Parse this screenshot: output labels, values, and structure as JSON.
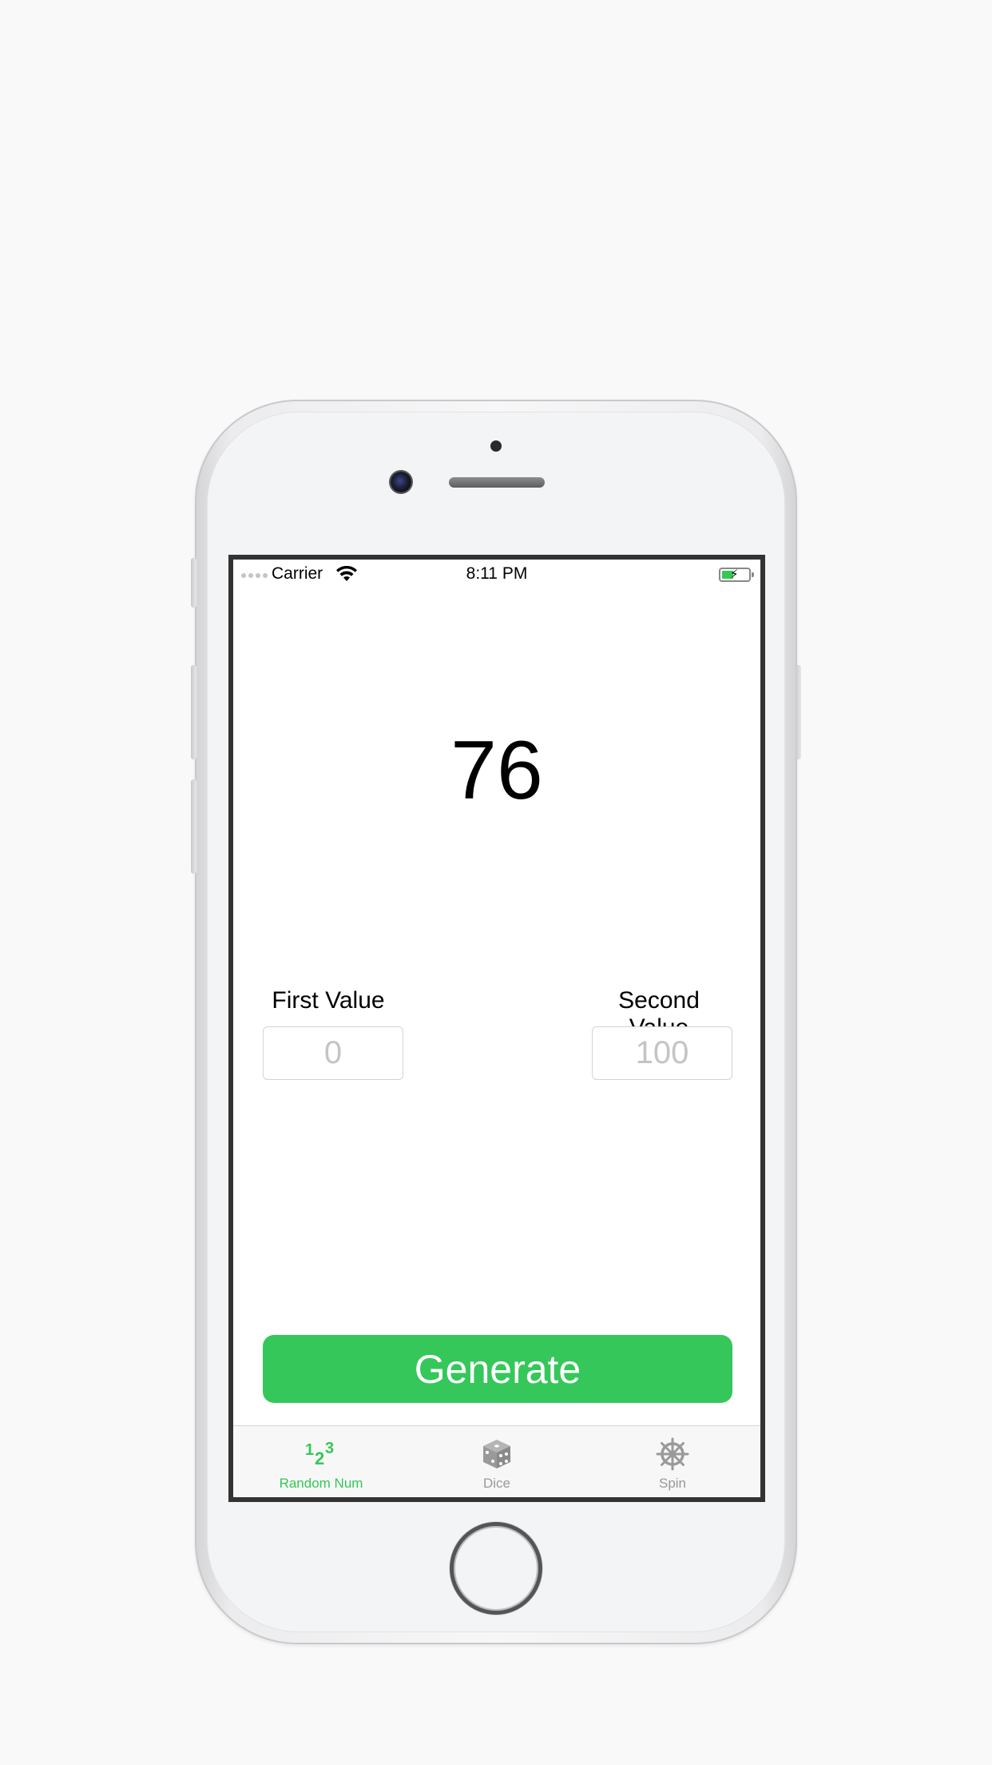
{
  "status_bar": {
    "carrier": "Carrier",
    "time": "8:11 PM"
  },
  "result": {
    "value": "76"
  },
  "first_value": {
    "label": "First Value",
    "placeholder": "0"
  },
  "second_value": {
    "label": "Second Value",
    "placeholder": "100"
  },
  "generate_button": {
    "label": "Generate"
  },
  "tab_bar": {
    "tabs": [
      {
        "label": "Random Num",
        "icon": "numbers-123-icon",
        "active": true
      },
      {
        "label": "Dice",
        "icon": "dice-icon",
        "active": false
      },
      {
        "label": "Spin",
        "icon": "ship-wheel-icon",
        "active": false
      }
    ]
  },
  "colors": {
    "accent": "#35c759",
    "button": "#35c75a",
    "inactive": "#999999",
    "placeholder": "#c4c4c4"
  }
}
